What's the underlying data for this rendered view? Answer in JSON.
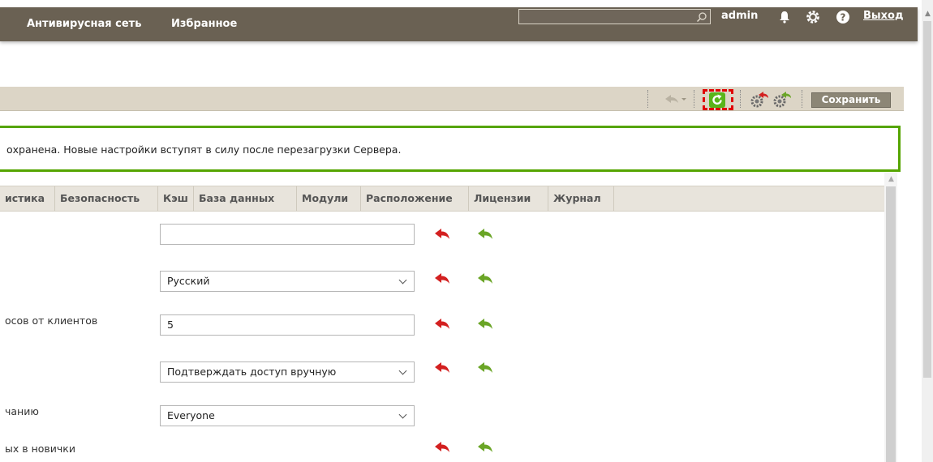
{
  "header": {
    "nav": [
      "Антивирусная сеть",
      "Избранное"
    ],
    "search": {
      "value": "",
      "placeholder": ""
    },
    "user": "admin",
    "logout": "Выход",
    "icons": [
      "bell-icon",
      "gear-icon",
      "help-icon"
    ]
  },
  "toolbar": {
    "save_label": "Сохранить",
    "icons": [
      "undo-dropdown-icon",
      "reload-icon",
      "restore-defaults-icon",
      "apply-settings-icon"
    ]
  },
  "notice": {
    "text": "охранена. Новые настройки вступят в силу после перезагрузки Сервера."
  },
  "tabs": [
    "истика",
    "Безопасность",
    "Кэш",
    "База данных",
    "Модули",
    "Расположение",
    "Лицензии",
    "Журнал"
  ],
  "form": {
    "rows": [
      {
        "label": "",
        "type": "input",
        "value": "",
        "arrows": true
      },
      {
        "label": "",
        "type": "select",
        "value": "Русский",
        "arrows": true
      },
      {
        "label": "осов от клиентов",
        "type": "input",
        "value": "5",
        "arrows": true
      },
      {
        "label": "",
        "type": "select",
        "value": "Подтверждать доступ вручную",
        "arrows": true
      },
      {
        "label": "чанию",
        "type": "select",
        "value": "Everyone",
        "arrows": false
      },
      {
        "label": "ых в новички",
        "type": "none",
        "value": "",
        "arrows": true
      }
    ]
  },
  "colors": {
    "topbar": "#6a6153",
    "toolbar": "#dcd5c6",
    "notice_border": "#55a500",
    "reset_arrow": "#d32020",
    "default_arrow": "#6aa526"
  }
}
